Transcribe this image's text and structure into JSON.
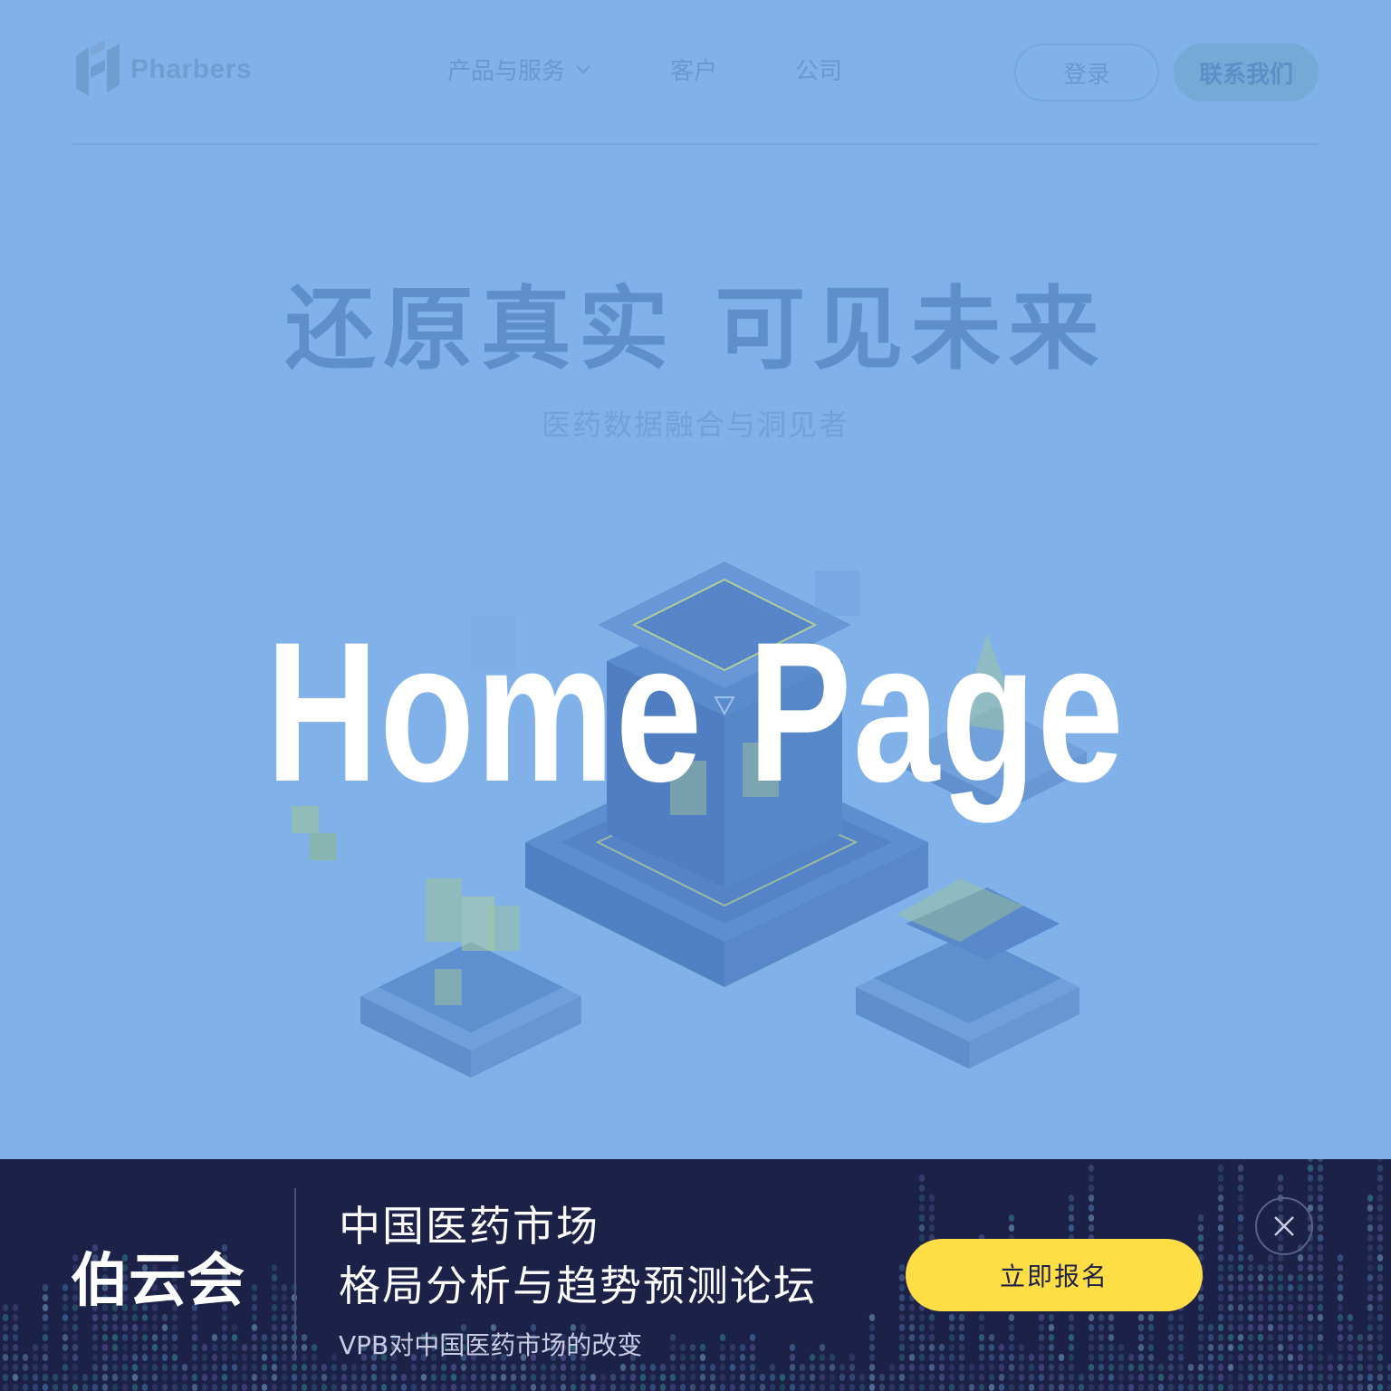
{
  "header": {
    "brand": "Pharbers",
    "nav": [
      {
        "label": "产品与服务",
        "icon": "chevron-down-icon"
      },
      {
        "label": "客户"
      },
      {
        "label": "公司"
      }
    ],
    "login_label": "登录",
    "contact_label": "联系我们"
  },
  "hero": {
    "title": "还原真实 可见未来",
    "subtitle": "医药数据融合与洞见者"
  },
  "overlay": {
    "title": "Home Page"
  },
  "banner": {
    "logo_text": "伯云会",
    "line1": "中国医药市场",
    "line2": "格局分析与趋势预测论坛",
    "line3": "VPB对中国医药市场的改变",
    "cta_label": "立即报名",
    "close_icon": "close-icon"
  },
  "colors": {
    "page_bg": "#80b2e9",
    "banner_bg": "#1c2147",
    "cta_bg": "#ffdd45"
  }
}
